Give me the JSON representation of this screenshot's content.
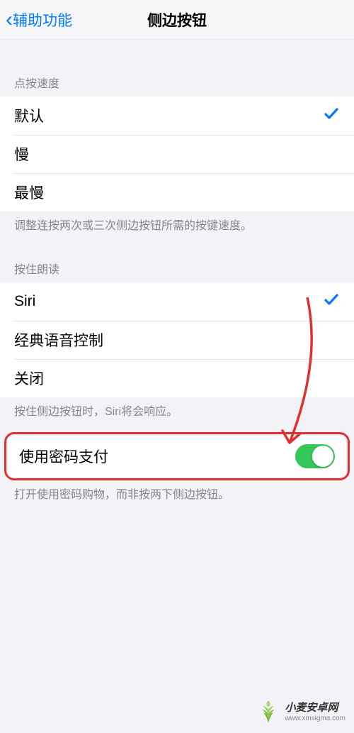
{
  "header": {
    "back_label": "辅助功能",
    "title": "侧边按钮"
  },
  "sections": {
    "click_speed": {
      "header": "点按速度",
      "options": [
        {
          "label": "默认",
          "selected": true
        },
        {
          "label": "慢",
          "selected": false
        },
        {
          "label": "最慢",
          "selected": false
        }
      ],
      "footer": "调整连按两次或三次侧边按钮所需的按键速度。"
    },
    "hold_to_speak": {
      "header": "按住朗读",
      "options": [
        {
          "label": "Siri",
          "selected": true
        },
        {
          "label": "经典语音控制",
          "selected": false
        },
        {
          "label": "关闭",
          "selected": false
        }
      ],
      "footer": "按住侧边按钮时，Siri将会响应。"
    },
    "payment": {
      "label": "使用密码支付",
      "enabled": true,
      "footer": "打开使用密码购物，而非按两下侧边按钮。"
    }
  },
  "watermark": {
    "name": "小麦安卓网",
    "url": "www.xmsigma.com"
  }
}
